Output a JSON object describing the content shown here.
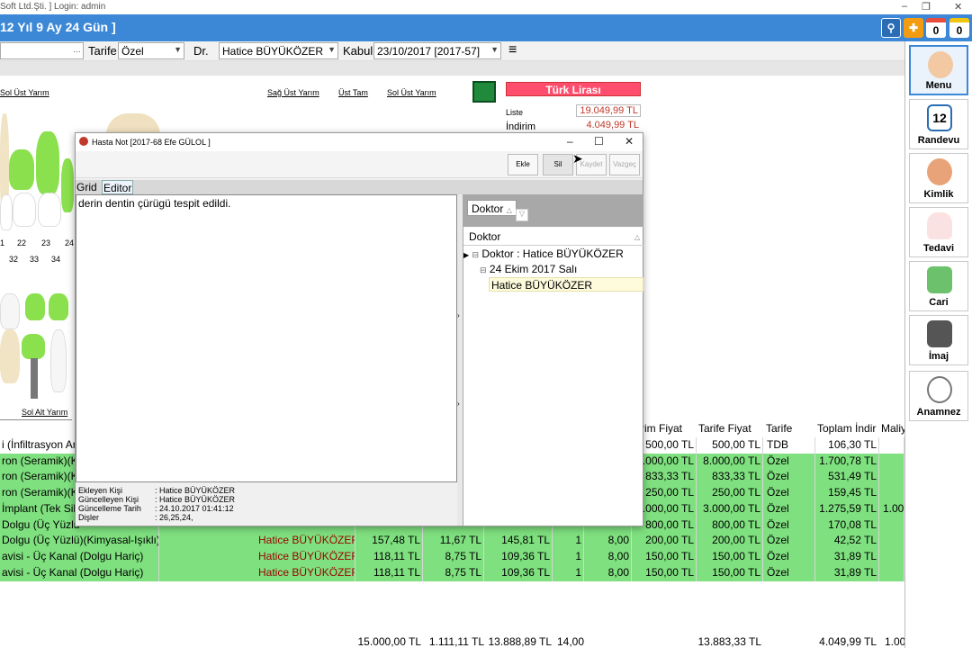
{
  "window": {
    "title": "Soft Ltd.Şti. ] Login: admin",
    "header_title": "12 Yıl 9 Ay 24 Gün ]",
    "badge_1": "0",
    "badge_2": "0"
  },
  "toolbar": {
    "tarife_label": "Tarife",
    "tarife_value": "Özel",
    "dr_label": "Dr.",
    "dr_value": "Hatice BÜYÜKÖZER",
    "kabul_label": "Kabul",
    "kabul_value": "23/10/2017 [2017-57]"
  },
  "chart": {
    "labels_top": [
      "Sol Üst Yarım",
      "Sağ Üst Yarım",
      "Üst Tam",
      "Sol Üst Yarım"
    ],
    "label_bottom": "Sol Alt Yarım",
    "numbers_upper": [
      "1",
      "22",
      "23",
      "24"
    ],
    "numbers_lower": [
      "32",
      "33",
      "34"
    ]
  },
  "currency": {
    "header": "Türk Lirası",
    "liste_label": "Liste",
    "liste_value": "19.049,99 TL",
    "indirim_label": "İndirim",
    "indirim_value": "4.049,99 TL"
  },
  "dialog": {
    "title": "Hasta Not [2017-68 Efe GÜLOL ]",
    "buttons": {
      "ekle": "Ekle",
      "sil": "Sil",
      "kaydet": "Kaydet",
      "vazgec": "Vazgeç"
    },
    "tabs": {
      "grid": "Grid",
      "editor": "Editor"
    },
    "editor_text": "derin dentin çürügü tespit edildi.",
    "meta": {
      "ekleyen_label": "Ekleyen Kişi",
      "ekleyen_value": ": Hatice BÜYÜKÖZER",
      "guncelleyen_label": "Güncelleyen Kişi",
      "guncelleyen_value": ": Hatice BÜYÜKÖZER",
      "guncelleme_label": "Güncelleme Tarih",
      "guncelleme_value": ": 24.10.2017 01:41:12",
      "disler_label": "Dişler",
      "disler_value": ": 26,25,24,"
    },
    "tree": {
      "group_chip": "Doktor",
      "column_header": "Doktor",
      "group_row": "Doktor : Hatice BÜYÜKÖZER",
      "date_row": "24 Ekim 2017 Salı",
      "leaf_row": "Hatice BÜYÜKÖZER"
    }
  },
  "grid": {
    "headers": [
      "rim Fiyat",
      "Tarife Fiyat",
      "Tarife",
      "Toplam İndir",
      "Maliy"
    ],
    "rows": [
      {
        "name": "i (İnfiltrasyon Ar",
        "doctor": "",
        "c1": "",
        "c2": "",
        "c3": "",
        "q": "",
        "p": "",
        "liste": "500,00 TL",
        "tarife_fiyat": "500,00 TL",
        "tarife": "TDB",
        "indirim": "106,30 TL",
        "maliyet": "",
        "green": false
      },
      {
        "name": "ron (Seramik)(K",
        "doctor": "",
        "c1": "",
        "c2": "",
        "c3": "",
        "q": "",
        "p": "",
        "liste": ".000,00 TL",
        "tarife_fiyat": "8.000,00 TL",
        "tarife": "Özel",
        "indirim": "1.700,78 TL",
        "maliyet": "",
        "green": true
      },
      {
        "name": "ron (Seramik)(K",
        "doctor": "",
        "c1": "",
        "c2": "",
        "c3": "",
        "q": "",
        "p": "",
        "liste": "833,33 TL",
        "tarife_fiyat": "833,33 TL",
        "tarife": "Özel",
        "indirim": "531,49 TL",
        "maliyet": "",
        "green": true
      },
      {
        "name": "ron (Seramik)(K",
        "doctor": "",
        "c1": "",
        "c2": "",
        "c3": "",
        "q": "",
        "p": "",
        "liste": "250,00 TL",
        "tarife_fiyat": "250,00 TL",
        "tarife": "Özel",
        "indirim": "159,45 TL",
        "maliyet": "",
        "green": true
      },
      {
        "name": "İmplant (Tek Sil",
        "doctor": "",
        "c1": "",
        "c2": "",
        "c3": "",
        "q": "",
        "p": "",
        "liste": ".000,00 TL",
        "tarife_fiyat": "3.000,00 TL",
        "tarife": "Özel",
        "indirim": "1.275,59 TL",
        "maliyet": "1.00",
        "green": true
      },
      {
        "name": "Dolgu (Üç Yüzlü",
        "doctor": "",
        "c1": "",
        "c2": "",
        "c3": "",
        "q": "",
        "p": "",
        "liste": "800,00 TL",
        "tarife_fiyat": "800,00 TL",
        "tarife": "Özel",
        "indirim": "170,08 TL",
        "maliyet": "",
        "green": true
      },
      {
        "name": "Dolgu (Üç Yüzlü)(Kimyasal-Işıklı)",
        "doctor": "Hatice BÜYÜKÖZER",
        "c1": "157,48 TL",
        "c2": "11,67 TL",
        "c3": "145,81 TL",
        "q": "1",
        "p": "8,00",
        "liste": "200,00 TL",
        "tarife_fiyat": "200,00 TL",
        "tarife": "Özel",
        "indirim": "42,52 TL",
        "maliyet": "",
        "green": true
      },
      {
        "name": "avisi - Üç Kanal (Dolgu Hariç)",
        "doctor": "Hatice BÜYÜKÖZER",
        "c1": "118,11 TL",
        "c2": "8,75 TL",
        "c3": "109,36 TL",
        "q": "1",
        "p": "8,00",
        "liste": "150,00 TL",
        "tarife_fiyat": "150,00 TL",
        "tarife": "Özel",
        "indirim": "31,89 TL",
        "maliyet": "",
        "green": true
      },
      {
        "name": "avisi - Üç Kanal (Dolgu Hariç)",
        "doctor": "Hatice BÜYÜKÖZER",
        "c1": "118,11 TL",
        "c2": "8,75 TL",
        "c3": "109,36 TL",
        "q": "1",
        "p": "8,00",
        "liste": "150,00 TL",
        "tarife_fiyat": "150,00 TL",
        "tarife": "Özel",
        "indirim": "31,89 TL",
        "maliyet": "",
        "green": true
      }
    ],
    "totals": {
      "t1": "15.000,00 TL",
      "t2": "1.111,11 TL",
      "t3": "13.888,89 TL",
      "t4": "14,00",
      "t5": "13.883,33 TL",
      "t6": "4.049,99 TL",
      "t7": "1.00"
    }
  },
  "menu": {
    "items": [
      "Menu",
      "Randevu",
      "Kimlik",
      "Tedavi",
      "Cari",
      "İmaj",
      "Anamnez"
    ],
    "calendar_day": "12"
  },
  "colors": {
    "accent": "#3c88d6",
    "green_row": "#7fe07f",
    "currency_header": "#ff4d6d"
  }
}
